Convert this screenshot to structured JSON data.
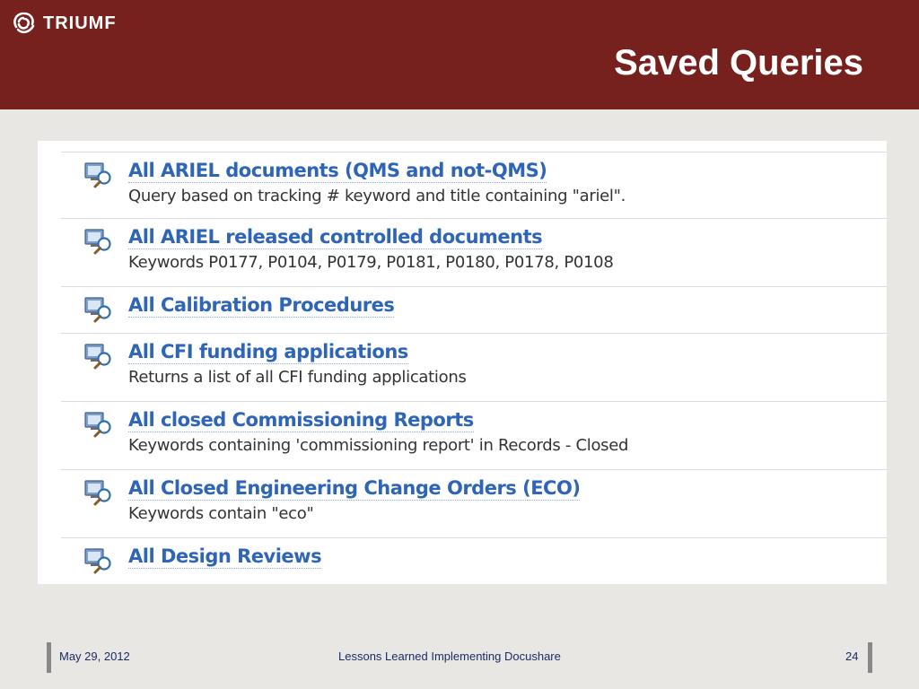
{
  "header": {
    "logo_text": "TRIUMF",
    "title": "Saved Queries"
  },
  "queries": [
    {
      "title": "All ARIEL documents (QMS and not-QMS)",
      "description": "Query based on tracking # keyword and title containing \"ariel\"."
    },
    {
      "title": "All ARIEL released controlled documents",
      "description": "Keywords P0177, P0104, P0179, P0181, P0180, P0178, P0108"
    },
    {
      "title": "All Calibration Procedures",
      "description": ""
    },
    {
      "title": "All CFI funding applications",
      "description": "Returns a list of all CFI funding applications"
    },
    {
      "title": "All closed Commissioning Reports",
      "description": "Keywords containing 'commissioning report' in Records - Closed"
    },
    {
      "title": "All Closed Engineering Change Orders (ECO)",
      "description": "Keywords contain \"eco\""
    },
    {
      "title": "All Design Reviews",
      "description": ""
    }
  ],
  "footer": {
    "date": "May 29, 2012",
    "center": "Lessons Learned Implementing Docushare",
    "page": "24"
  },
  "colors": {
    "header_bg": "#76211d",
    "link": "#2e65b6",
    "footer_text": "#1d2a66"
  }
}
